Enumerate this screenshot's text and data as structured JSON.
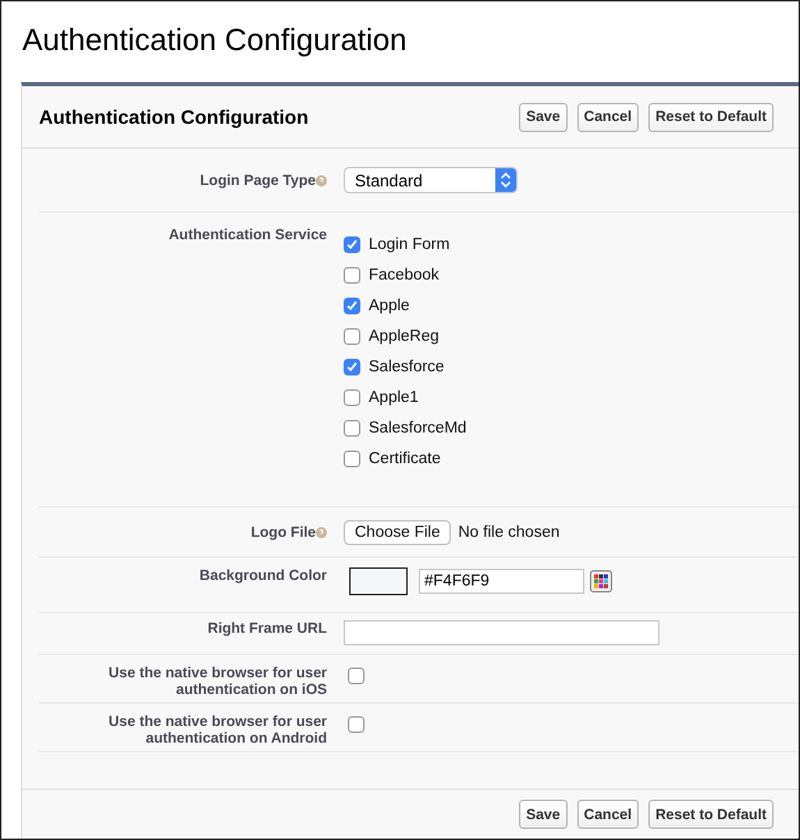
{
  "page_title": "Authentication Configuration",
  "panel": {
    "title": "Authentication Configuration",
    "buttons": [
      "Save",
      "Cancel",
      "Reset to Default"
    ]
  },
  "fields": [
    {
      "kind": "select",
      "label": "Login Page Type",
      "help": true,
      "value": "Standard"
    },
    {
      "kind": "checklist",
      "label": "Authentication Service",
      "options": [
        {
          "label": "Login Form",
          "checked": true
        },
        {
          "label": "Facebook",
          "checked": false
        },
        {
          "label": "Apple",
          "checked": true
        },
        {
          "label": "AppleReg",
          "checked": false
        },
        {
          "label": "Salesforce",
          "checked": true
        },
        {
          "label": "Apple1",
          "checked": false
        },
        {
          "label": "SalesforceMd",
          "checked": false
        },
        {
          "label": "Certificate",
          "checked": false
        }
      ]
    },
    {
      "kind": "file",
      "label": "Logo File",
      "help": true,
      "button": "Choose File",
      "status": "No file chosen"
    },
    {
      "kind": "color",
      "label": "Background Color",
      "value": "#F4F6F9",
      "color": "#f4f6f9"
    },
    {
      "kind": "text",
      "label": "Right Frame URL"
    },
    {
      "kind": "checkbox",
      "label": "Use the native browser for user authentication on iOS",
      "checked": false
    },
    {
      "kind": "checkbox",
      "label": "Use the native browser for user authentication on Android",
      "checked": false
    }
  ],
  "footer_buttons": [
    "Save",
    "Cancel",
    "Reset to Default"
  ]
}
